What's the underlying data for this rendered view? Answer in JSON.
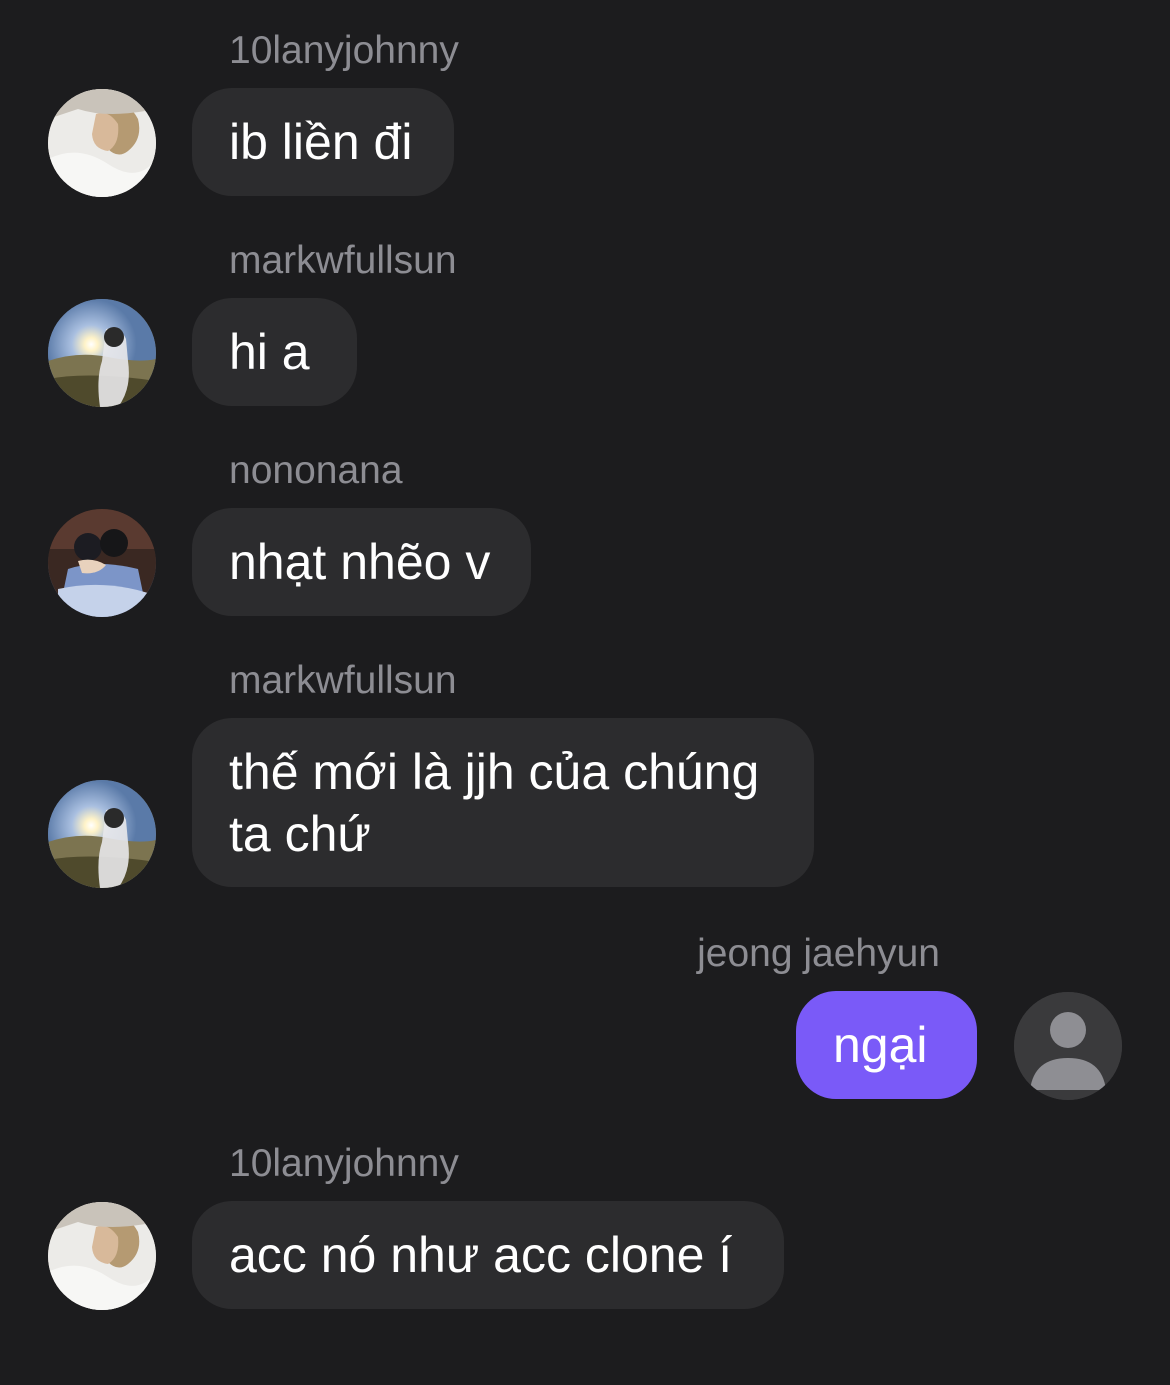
{
  "messages": [
    {
      "sender": "10lanyjohnny",
      "text": "ib liền đi",
      "avatar": "bed-photo-avatar",
      "direction": "incoming"
    },
    {
      "sender": "markwfullsun",
      "text": "hi a",
      "avatar": "sunset-photo-avatar",
      "direction": "incoming"
    },
    {
      "sender": "nononana",
      "text": "nhạt nhẽo v",
      "avatar": "couple-photo-avatar",
      "direction": "incoming"
    },
    {
      "sender": "markwfullsun",
      "text": "thế mới là jjh của chúng ta chứ",
      "avatar": "sunset-photo-avatar",
      "direction": "incoming"
    },
    {
      "sender": "jeong jaehyun",
      "text": "ngại",
      "avatar": "default-user-icon",
      "direction": "outgoing"
    },
    {
      "sender": "10lanyjohnny",
      "text": "acc nó như acc clone í",
      "avatar": "bed-photo-avatar",
      "direction": "incoming"
    }
  ],
  "colors": {
    "background": "#1c1c1e",
    "incoming_bubble": "#2c2c2e",
    "outgoing_bubble": "#7a5af8",
    "sender_text": "#8d8d93",
    "message_text": "#ffffff"
  }
}
